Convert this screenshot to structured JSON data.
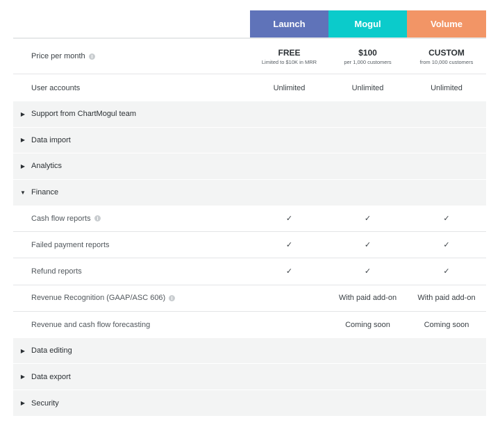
{
  "plans": [
    {
      "name": "Launch",
      "color": "#5f73b9",
      "price": "FREE",
      "price_note": "Limited to $10K in MRR",
      "user_accounts": "Unlimited"
    },
    {
      "name": "Mogul",
      "color": "#0bcbcb",
      "price": "$100",
      "price_note": "per 1,000 customers",
      "user_accounts": "Unlimited"
    },
    {
      "name": "Volume",
      "color": "#f29566",
      "price": "CUSTOM",
      "price_note": "from 10,000 customers",
      "user_accounts": "Unlimited"
    }
  ],
  "rows": {
    "price_label": "Price per month",
    "users_label": "User accounts"
  },
  "sections_before": [
    {
      "title": "Support from ChartMogul team",
      "expanded": false,
      "arrow": "▶"
    },
    {
      "title": "Data import",
      "expanded": false,
      "arrow": "▶"
    },
    {
      "title": "Analytics",
      "expanded": false,
      "arrow": "▶"
    }
  ],
  "finance": {
    "title": "Finance",
    "expanded": true,
    "arrow": "▼",
    "items": [
      {
        "label": "Cash flow reports",
        "info": true,
        "values": [
          "✓",
          "✓",
          "✓"
        ]
      },
      {
        "label": "Failed payment reports",
        "info": false,
        "values": [
          "✓",
          "✓",
          "✓"
        ]
      },
      {
        "label": "Refund reports",
        "info": false,
        "values": [
          "✓",
          "✓",
          "✓"
        ]
      },
      {
        "label": "Revenue Recognition (GAAP/ASC 606)",
        "info": true,
        "values": [
          "",
          "With paid add-on",
          "With paid add-on"
        ]
      },
      {
        "label": "Revenue and cash flow forecasting",
        "info": false,
        "values": [
          "",
          "Coming soon",
          "Coming soon"
        ]
      }
    ]
  },
  "sections_after": [
    {
      "title": "Data editing",
      "expanded": false,
      "arrow": "▶"
    },
    {
      "title": "Data export",
      "expanded": false,
      "arrow": "▶"
    },
    {
      "title": "Security",
      "expanded": false,
      "arrow": "▶"
    }
  ],
  "colors": {
    "check": "#4caf67",
    "section_bg": "#f3f4f4"
  }
}
